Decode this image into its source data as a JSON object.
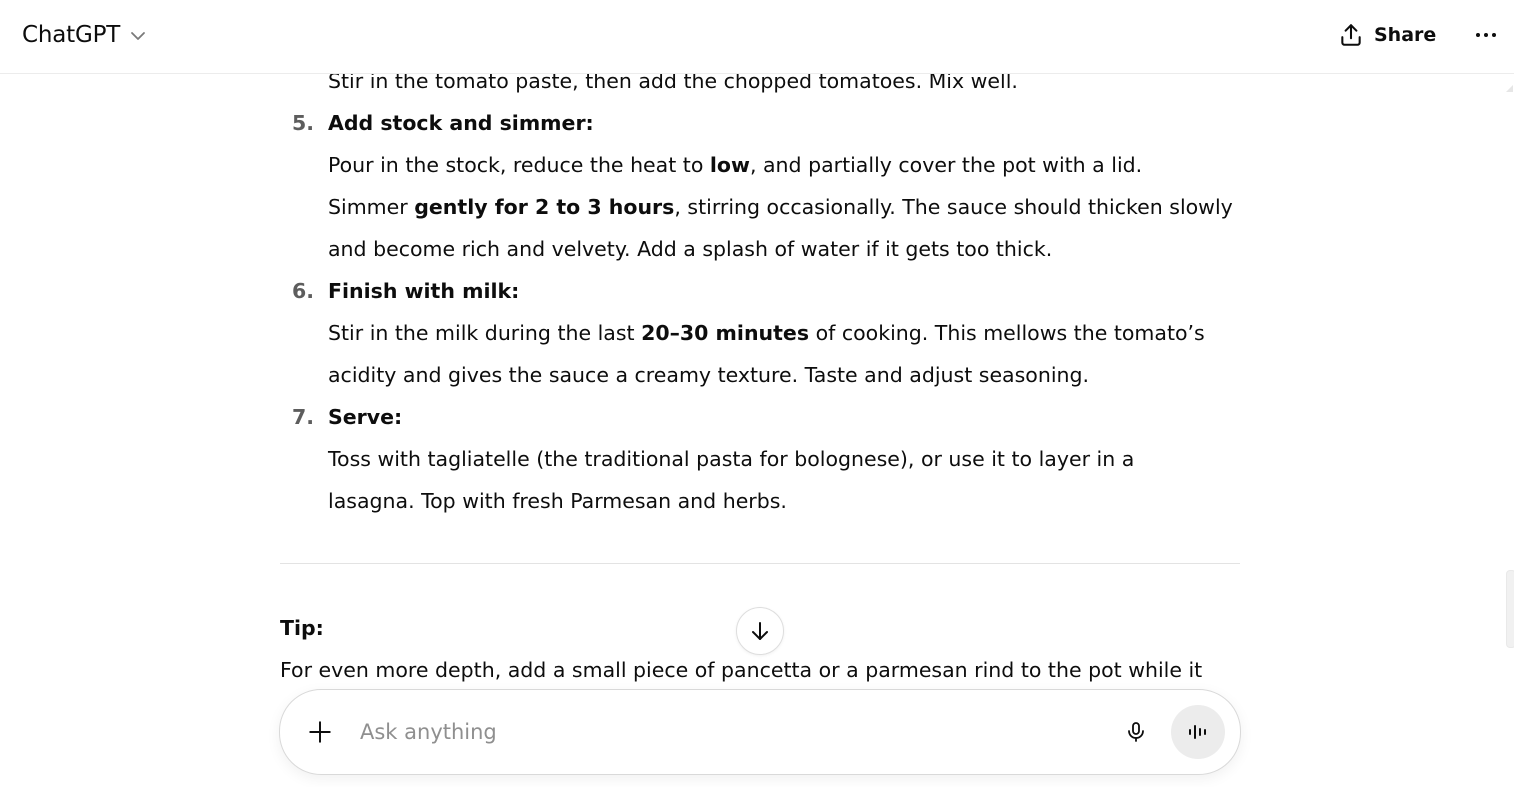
{
  "header": {
    "model_name": "ChatGPT",
    "share_label": "Share"
  },
  "message": {
    "step4_body_tail": "Stir in the tomato paste, then add the chopped tomatoes. Mix well.",
    "steps": [
      {
        "number": "5.",
        "title": "Add stock and simmer:",
        "lines": [
          [
            "Pour in the stock, reduce the heat to ",
            "low",
            ", and partially cover the pot with a lid."
          ],
          [
            "Simmer ",
            "gently for 2 to 3 hours",
            ", stirring occasionally. The sauce should thicken slowly"
          ],
          [
            "and become rich and velvety. Add a splash of water if it gets too thick."
          ]
        ]
      },
      {
        "number": "6.",
        "title": "Finish with milk:",
        "lines": [
          [
            "Stir in the milk during the last ",
            "20–30 minutes",
            " of cooking. This mellows the tomato’s"
          ],
          [
            "acidity and gives the sauce a creamy texture. Taste and adjust seasoning."
          ]
        ]
      },
      {
        "number": "7.",
        "title": "Serve:",
        "lines": [
          [
            "Toss with tagliatelle (the traditional pasta for bolognese), or use it to layer in a"
          ],
          [
            "lasagna. Top with fresh Parmesan and herbs."
          ]
        ]
      }
    ],
    "tip_label": "Tip:",
    "tip_text": "For even more depth, add a small piece of pancetta or a parmesan rind to the pot while it"
  },
  "composer": {
    "placeholder": "Ask anything"
  },
  "icons": {
    "model_chevron": "chevron-down-icon",
    "share": "share-upload-icon",
    "more": "more-horizontal-icon",
    "scroll_down": "arrow-down-icon",
    "attach": "plus-icon",
    "mic": "microphone-icon",
    "voice": "voice-mode-icon"
  },
  "colors": {
    "text": "#0d0d0d",
    "list_number": "#5d5d5d",
    "placeholder": "#8f8f8f",
    "voice_button_bg": "#ececec"
  }
}
